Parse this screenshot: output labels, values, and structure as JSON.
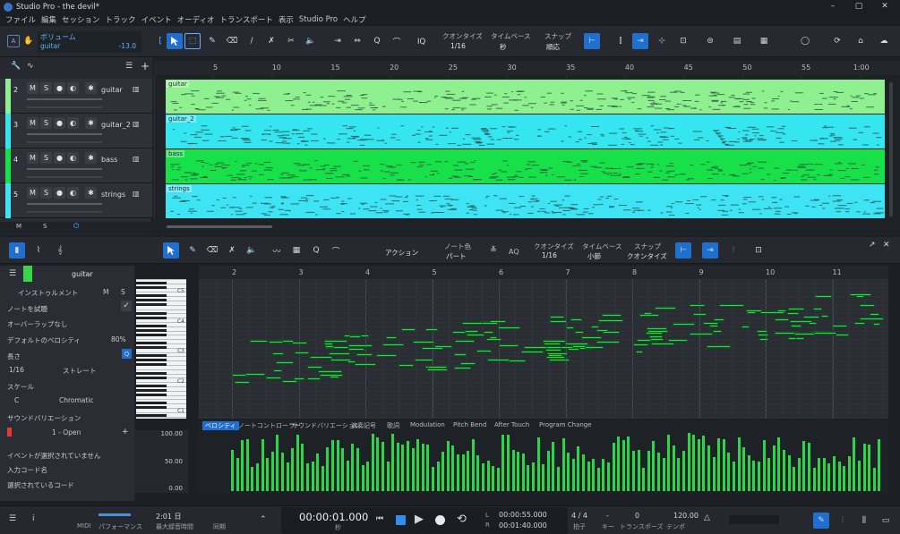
{
  "window": {
    "title": "Studio Pro - the devil*",
    "controls": [
      "minimize-icon",
      "maximize-icon",
      "close-icon"
    ]
  },
  "menu": [
    "ファイル",
    "編集",
    "セッション",
    "トラック",
    "イベント",
    "オーディオ",
    "トランスポート",
    "表示",
    "Studio Pro",
    "ヘルプ"
  ],
  "toolbar": {
    "volume_label": "ボリューム",
    "volume_track": "guitar",
    "volume_value": "-13.0",
    "iq": "IQ",
    "quantize_label": "クオンタイズ",
    "quantize_value": "1/16",
    "timebase_label": "タイムベース",
    "timebase_value": "秒",
    "snap_label": "スナップ",
    "snap_value": "順応"
  },
  "arrange": {
    "ruler": [
      "5",
      "10",
      "15",
      "20",
      "25",
      "30",
      "35",
      "40",
      "45",
      "50",
      "55",
      "1:00"
    ],
    "tracks": [
      {
        "num": "2",
        "name": "guitar",
        "color": "#8ef08e",
        "clip": "guitar"
      },
      {
        "num": "3",
        "name": "guitar_2",
        "color": "#35e5f0",
        "clip": "guitar_2"
      },
      {
        "num": "4",
        "name": "bass",
        "color": "#18e048",
        "clip": "bass"
      },
      {
        "num": "5",
        "name": "strings",
        "color": "#3fe4f4",
        "clip": "strings"
      }
    ],
    "footer": [
      "M",
      "S"
    ]
  },
  "editor": {
    "action_label": "アクション",
    "notecolor_label": "ノート色",
    "notecolor_value": "パート",
    "aq": "AQ",
    "quantize_label": "クオンタイズ",
    "quantize_value": "1/16",
    "timebase_label": "タイムベース",
    "timebase_value": "小節",
    "snap_label": "スナップ",
    "snap_value": "クオンタイズ",
    "ruler": [
      "2",
      "3",
      "4",
      "5",
      "6",
      "7",
      "8",
      "9",
      "10",
      "11"
    ],
    "key_labels": [
      "C5",
      "C4",
      "C3",
      "C2",
      "C1"
    ]
  },
  "inspector": {
    "track_name": "guitar",
    "instrument": "インストゥルメント",
    "m": "M",
    "s": "S",
    "note_preview": "ノートを試聴",
    "overlap": "オーバーラップなし",
    "default_velocity": "デフォルトのベロシティ",
    "default_velocity_value": "80%",
    "length": "長さ",
    "length_value": "1/16",
    "length_mode": "ストレート",
    "scale": "スケール",
    "scale_root": "C",
    "scale_type": "Chromatic",
    "sound_variation": "サウンドバリエーション",
    "sound_variation_value": "1 - Open",
    "no_event": "イベントが選択されていません",
    "input_chord": "入力コード名",
    "selected_chord": "選択されているコード"
  },
  "tabs": [
    "ベロシティ",
    "ノートコントローラー",
    "サウンドバリエーション",
    "演奏記号",
    "歌詞",
    "Modulation",
    "Pitch Bend",
    "After Touch",
    "Program Change"
  ],
  "velocity_scale": [
    "100.00",
    "50.00",
    "0.00"
  ],
  "transport": {
    "midi": "MIDI",
    "performance": "パフォーマンス",
    "rec_time": "2:01 日",
    "rec_time_label": "最大録音時間",
    "sync": "同期",
    "time": "00:00:01.000",
    "time_unit": "秒",
    "loop_l": "L",
    "loop_r": "R",
    "loop_start": "00:00:55.000",
    "loop_end": "00:01:40.000",
    "signature": "4 / 4",
    "signature_label": "拍子",
    "key": "-",
    "key_label": "キー",
    "transpose": "0",
    "transpose_label": "トランスポーズ",
    "tempo": "120.00",
    "tempo_label": "テンポ"
  },
  "colors": {
    "accent": "#1f6fd1",
    "note": "#2bd64a",
    "record": "#e53935"
  }
}
